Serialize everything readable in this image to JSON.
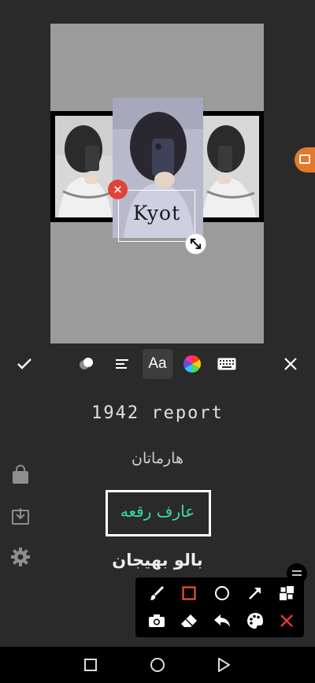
{
  "canvas": {
    "sticker_text": "Kyot"
  },
  "toolbar": {
    "font_button_label": "Aa",
    "confirm_icon": "checkmark-icon",
    "eraser_icon": "eraser-icon",
    "align_icon": "text-align-icon",
    "color_icon": "color-wheel-icon",
    "keyboard_icon": "keyboard-icon",
    "close_icon": "close-icon"
  },
  "fonts": {
    "items": [
      {
        "label": "1942 report"
      },
      {
        "label": "هارماتان"
      },
      {
        "label": "عارف رقعه",
        "selected": true
      },
      {
        "label": "بالو بهيجان"
      }
    ],
    "selected_color": "#35e0b0"
  },
  "side_icons": [
    "shopping-bag-icon",
    "download-icon",
    "settings-icon"
  ],
  "draw_panel": {
    "tools": [
      "brush-icon",
      "rectangle-icon",
      "circle-icon",
      "arrow-icon",
      "mosaic-icon",
      "camera-icon",
      "eraser-icon",
      "undo-icon",
      "palette-icon",
      "close-icon"
    ],
    "accent_color": "#e8552f"
  },
  "colors": {
    "background": "#2a2a2a",
    "canvas": "#9b9b9b",
    "delete": "#e04436",
    "record": "#e27a2a"
  }
}
